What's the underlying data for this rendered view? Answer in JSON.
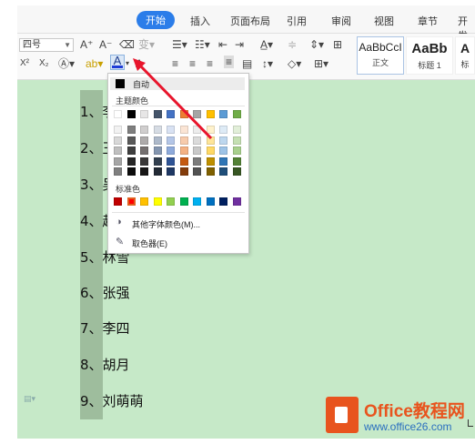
{
  "tabs": [
    "开始",
    "插入",
    "页面布局",
    "引用",
    "审阅",
    "视图",
    "章节",
    "开发"
  ],
  "font_size_value": "四号",
  "styles": [
    {
      "sample": "AaBbCcI",
      "name": "正文"
    },
    {
      "sample": "AaBb",
      "name": "标题 1"
    },
    {
      "sample": "A",
      "name": "标"
    }
  ],
  "list_items": [
    "1、李",
    "2、王",
    "3、吴",
    "4、赵",
    "5、林雪",
    "6、张强",
    "7、李四",
    "8、胡月",
    "9、刘萌萌"
  ],
  "color_menu": {
    "auto_label": "自动",
    "theme_label": "主题颜色",
    "standard_label": "标准色",
    "more_colors_label": "其他字体颜色(M)...",
    "picker_label": "取色器(E)",
    "theme_top": [
      "#ffffff",
      "#000000",
      "#e7e6e6",
      "#44546a",
      "#4472c4",
      "#ed7d31",
      "#a5a5a5",
      "#ffc000",
      "#5b9bd5",
      "#70ad47"
    ],
    "theme_shades": [
      [
        "#f2f2f2",
        "#7f7f7f",
        "#d0cece",
        "#d6dce4",
        "#d9e2f3",
        "#fbe5d5",
        "#ededed",
        "#fff2cc",
        "#deebf6",
        "#e2efd9"
      ],
      [
        "#d8d8d8",
        "#595959",
        "#aeabab",
        "#adb9ca",
        "#b4c6e7",
        "#f7cbac",
        "#dbdbdb",
        "#fee599",
        "#bdd7ee",
        "#c5e0b3"
      ],
      [
        "#bfbfbf",
        "#3f3f3f",
        "#757070",
        "#8496b0",
        "#8eaadb",
        "#f4b183",
        "#c9c9c9",
        "#ffd965",
        "#9dc3e6",
        "#a8d08d"
      ],
      [
        "#a5a5a5",
        "#262626",
        "#3a3838",
        "#323f4f",
        "#2f5496",
        "#c55a11",
        "#7b7b7b",
        "#bf9000",
        "#2e75b5",
        "#538135"
      ],
      [
        "#7f7f7f",
        "#0c0c0c",
        "#171616",
        "#222a35",
        "#1f3864",
        "#833c0b",
        "#525252",
        "#7f6000",
        "#1e4e79",
        "#375623"
      ]
    ],
    "standard": [
      "#c00000",
      "#ff0000",
      "#ffc000",
      "#ffff00",
      "#92d050",
      "#00b050",
      "#00b0f0",
      "#0070c0",
      "#002060",
      "#7030a0"
    ],
    "selected_standard_index": 1
  },
  "logo": {
    "title": "Office教程网",
    "url": "www.office26.com"
  },
  "accent_arrow_color": "#e8152c"
}
